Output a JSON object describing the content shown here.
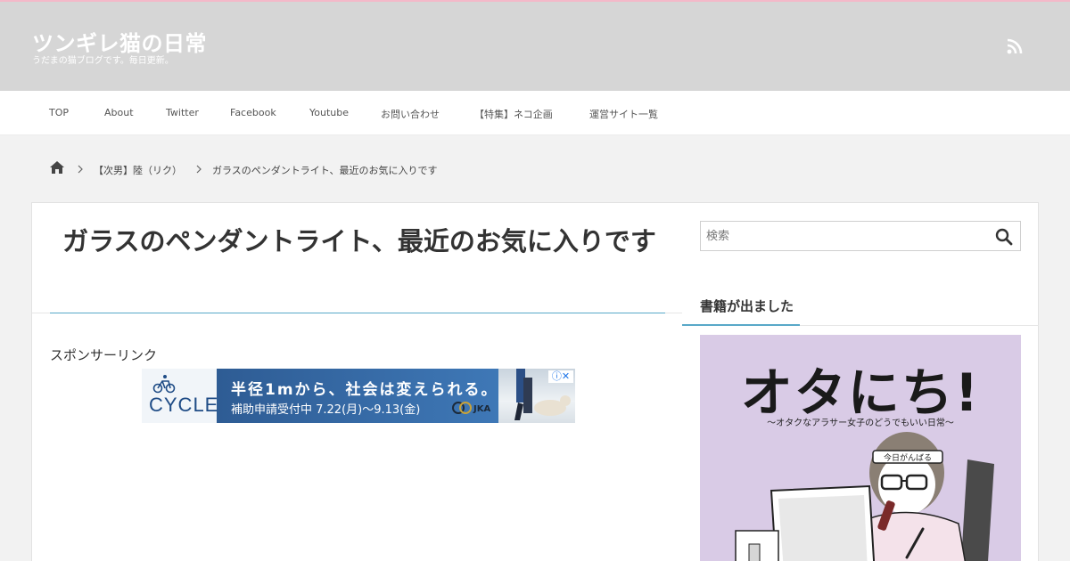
{
  "header": {
    "site_title": "ツンギレ猫の日常",
    "site_description": "うだまの猫ブログです。毎日更新。",
    "rss_icon": "rss-icon",
    "background_color": "#d6d6d6",
    "accent_top_color": "#f4b9c9"
  },
  "nav": {
    "items": [
      {
        "label": "TOP"
      },
      {
        "label": "About"
      },
      {
        "label": "Twitter"
      },
      {
        "label": "Facebook"
      },
      {
        "label": "Youtube"
      },
      {
        "label": "お問い合わせ"
      },
      {
        "label": "【特集】ネコ企画"
      },
      {
        "label": "運営サイト一覧"
      }
    ]
  },
  "breadcrumb": {
    "home_icon": "home-icon",
    "items": [
      {
        "label": "【次男】陸（リク）"
      },
      {
        "label": "ガラスのペンダントライト、最近のお気に入りです"
      }
    ]
  },
  "article": {
    "title": "ガラスのペンダントライト、最近のお気に入りです",
    "sponsor_label": "スポンサーリンク",
    "accent_color": "#58a8c8"
  },
  "ad": {
    "brand": "CYCLE",
    "headline": "半径1mから、社会は変えられる。",
    "subline": "補助申請受付中 7.22(月)～9.13(金)",
    "sponsor_mark": "JKA",
    "close_glyph": "ⓘ✕"
  },
  "sidebar": {
    "search": {
      "placeholder": "検索",
      "button_icon": "search-icon"
    },
    "widget_title": "書籍が出ました",
    "book": {
      "title": "オタにち!",
      "subtitle": "～オタクなアラサー女子のどうでもいい日常～",
      "headband_text": "今日がんばる"
    }
  }
}
